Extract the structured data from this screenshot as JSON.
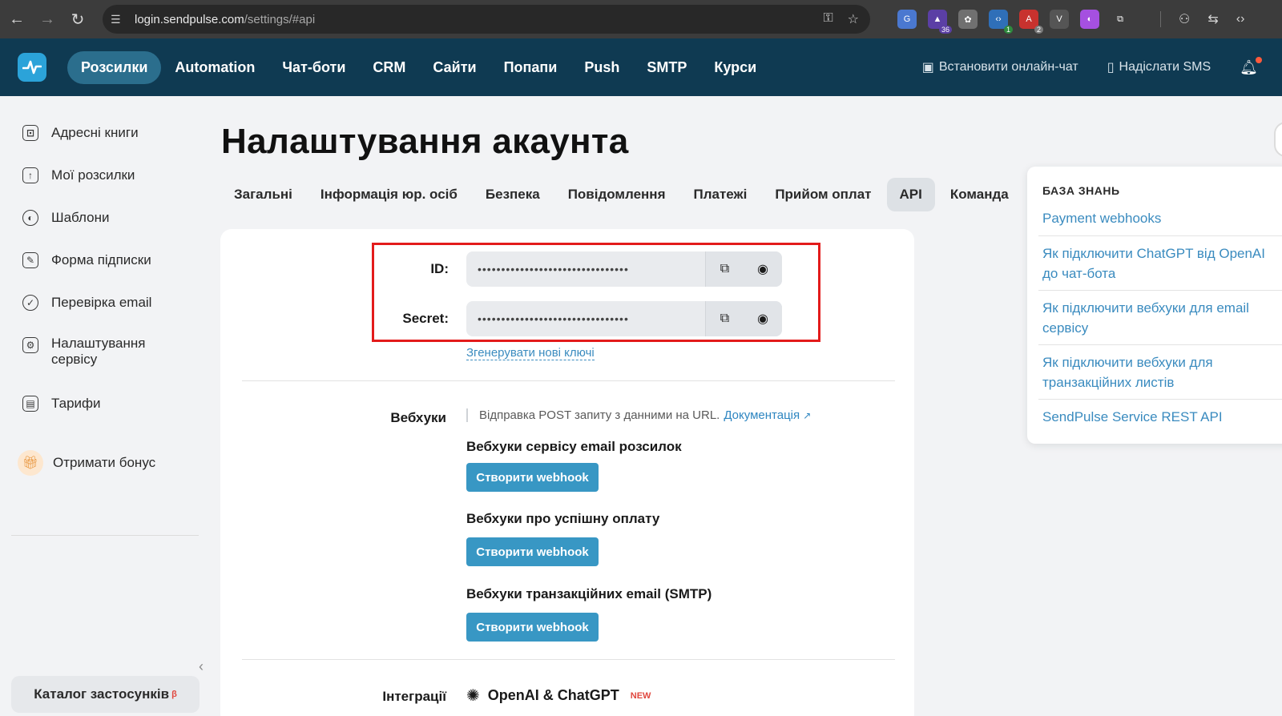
{
  "browser": {
    "url_host": "login.sendpulse.com",
    "url_path": "/settings/#api",
    "extensions": [
      {
        "name": "translate-ext",
        "color": "#4a78d0",
        "badge": "",
        "glyph": "G"
      },
      {
        "name": "graduation-ext",
        "color": "#5b3fa5",
        "badge": "36",
        "glyph": "▲"
      },
      {
        "name": "settings-ext",
        "color": "#707070",
        "badge": "",
        "glyph": "✿"
      },
      {
        "name": "code-ext",
        "color": "#2f6fb8",
        "badge": "1",
        "glyph": "‹›"
      },
      {
        "name": "api-ext",
        "color": "#c8322e",
        "badge": "2",
        "glyph": "A"
      },
      {
        "name": "v-ext",
        "color": "#555555",
        "badge": "",
        "glyph": "V"
      },
      {
        "name": "gradient-ext",
        "color": "#a550e0",
        "badge": "",
        "glyph": "◐"
      },
      {
        "name": "puzzle-ext",
        "color": "#3c3c3c",
        "badge": "",
        "glyph": "⧉"
      }
    ]
  },
  "header": {
    "nav": [
      "Розсилки",
      "Automation",
      "Чат-боти",
      "CRM",
      "Сайти",
      "Попапи",
      "Push",
      "SMTP",
      "Курси"
    ],
    "active_nav": "Розсилки",
    "chat_link": "Встановити онлайн-чат",
    "sms_link": "Надіслати SMS"
  },
  "sidebar": {
    "items": [
      {
        "label": "Адресні книги",
        "icon": "address-book-icon",
        "glyph": "⊡"
      },
      {
        "label": "Мої розсилки",
        "icon": "mailings-icon",
        "glyph": "↑"
      },
      {
        "label": "Шаблони",
        "icon": "templates-icon",
        "glyph": "◐"
      },
      {
        "label": "Форма підписки",
        "icon": "subscription-form-icon",
        "glyph": "✎"
      },
      {
        "label": "Перевірка email",
        "icon": "email-check-icon",
        "glyph": "✓"
      },
      {
        "label": "Налаштування сервісу",
        "icon": "service-settings-icon",
        "glyph": "⚙"
      },
      {
        "label": "Тарифи",
        "icon": "pricing-icon",
        "glyph": "▤"
      }
    ],
    "bonus": "Отримати бонус",
    "catalog": "Каталог застосунків",
    "catalog_badge": "β"
  },
  "main": {
    "title": "Налаштування акаунта",
    "tabs": [
      "Загальні",
      "Інформація юр. осіб",
      "Безпека",
      "Повідомлення",
      "Платежі",
      "Прийом оплат",
      "API",
      "Команда"
    ],
    "active_tab": "API",
    "api": {
      "id_label": "ID:",
      "id_value": "••••••••••••••••••••••••••••••••",
      "secret_label": "Secret:",
      "secret_value": "••••••••••••••••••••••••••••••••",
      "generate_link": "Згенерувати нові ключі"
    },
    "webhooks": {
      "label": "Вебхуки",
      "description": "Відправка POST запиту з данними на URL.",
      "doc_link": "Документація",
      "groups": [
        {
          "title": "Вебхуки сервісу email розсилок",
          "button": "Створити webhook"
        },
        {
          "title": "Вебхуки про успішну оплату",
          "button": "Створити webhook"
        },
        {
          "title": "Вебхуки транзакційних email (SMTP)",
          "button": "Створити webhook"
        }
      ]
    },
    "integrations": {
      "label": "Інтеграції",
      "item": "OpenAI & ChatGPT",
      "badge": "NEW"
    }
  },
  "knowledge_base": {
    "title": "БАЗА ЗНАНЬ",
    "links": [
      "Payment webhooks",
      "Як підключити ChatGPT від OpenAI до чат-бота",
      "Як підключити вебхуки для email сервісу",
      "Як підключити вебхуки для транзакційних листів",
      "SendPulse Service REST API"
    ]
  },
  "colors": {
    "header_bg": "#0f3a52",
    "accent": "#3897c4",
    "link": "#3a8bbf",
    "highlight": "#e31b1b"
  }
}
